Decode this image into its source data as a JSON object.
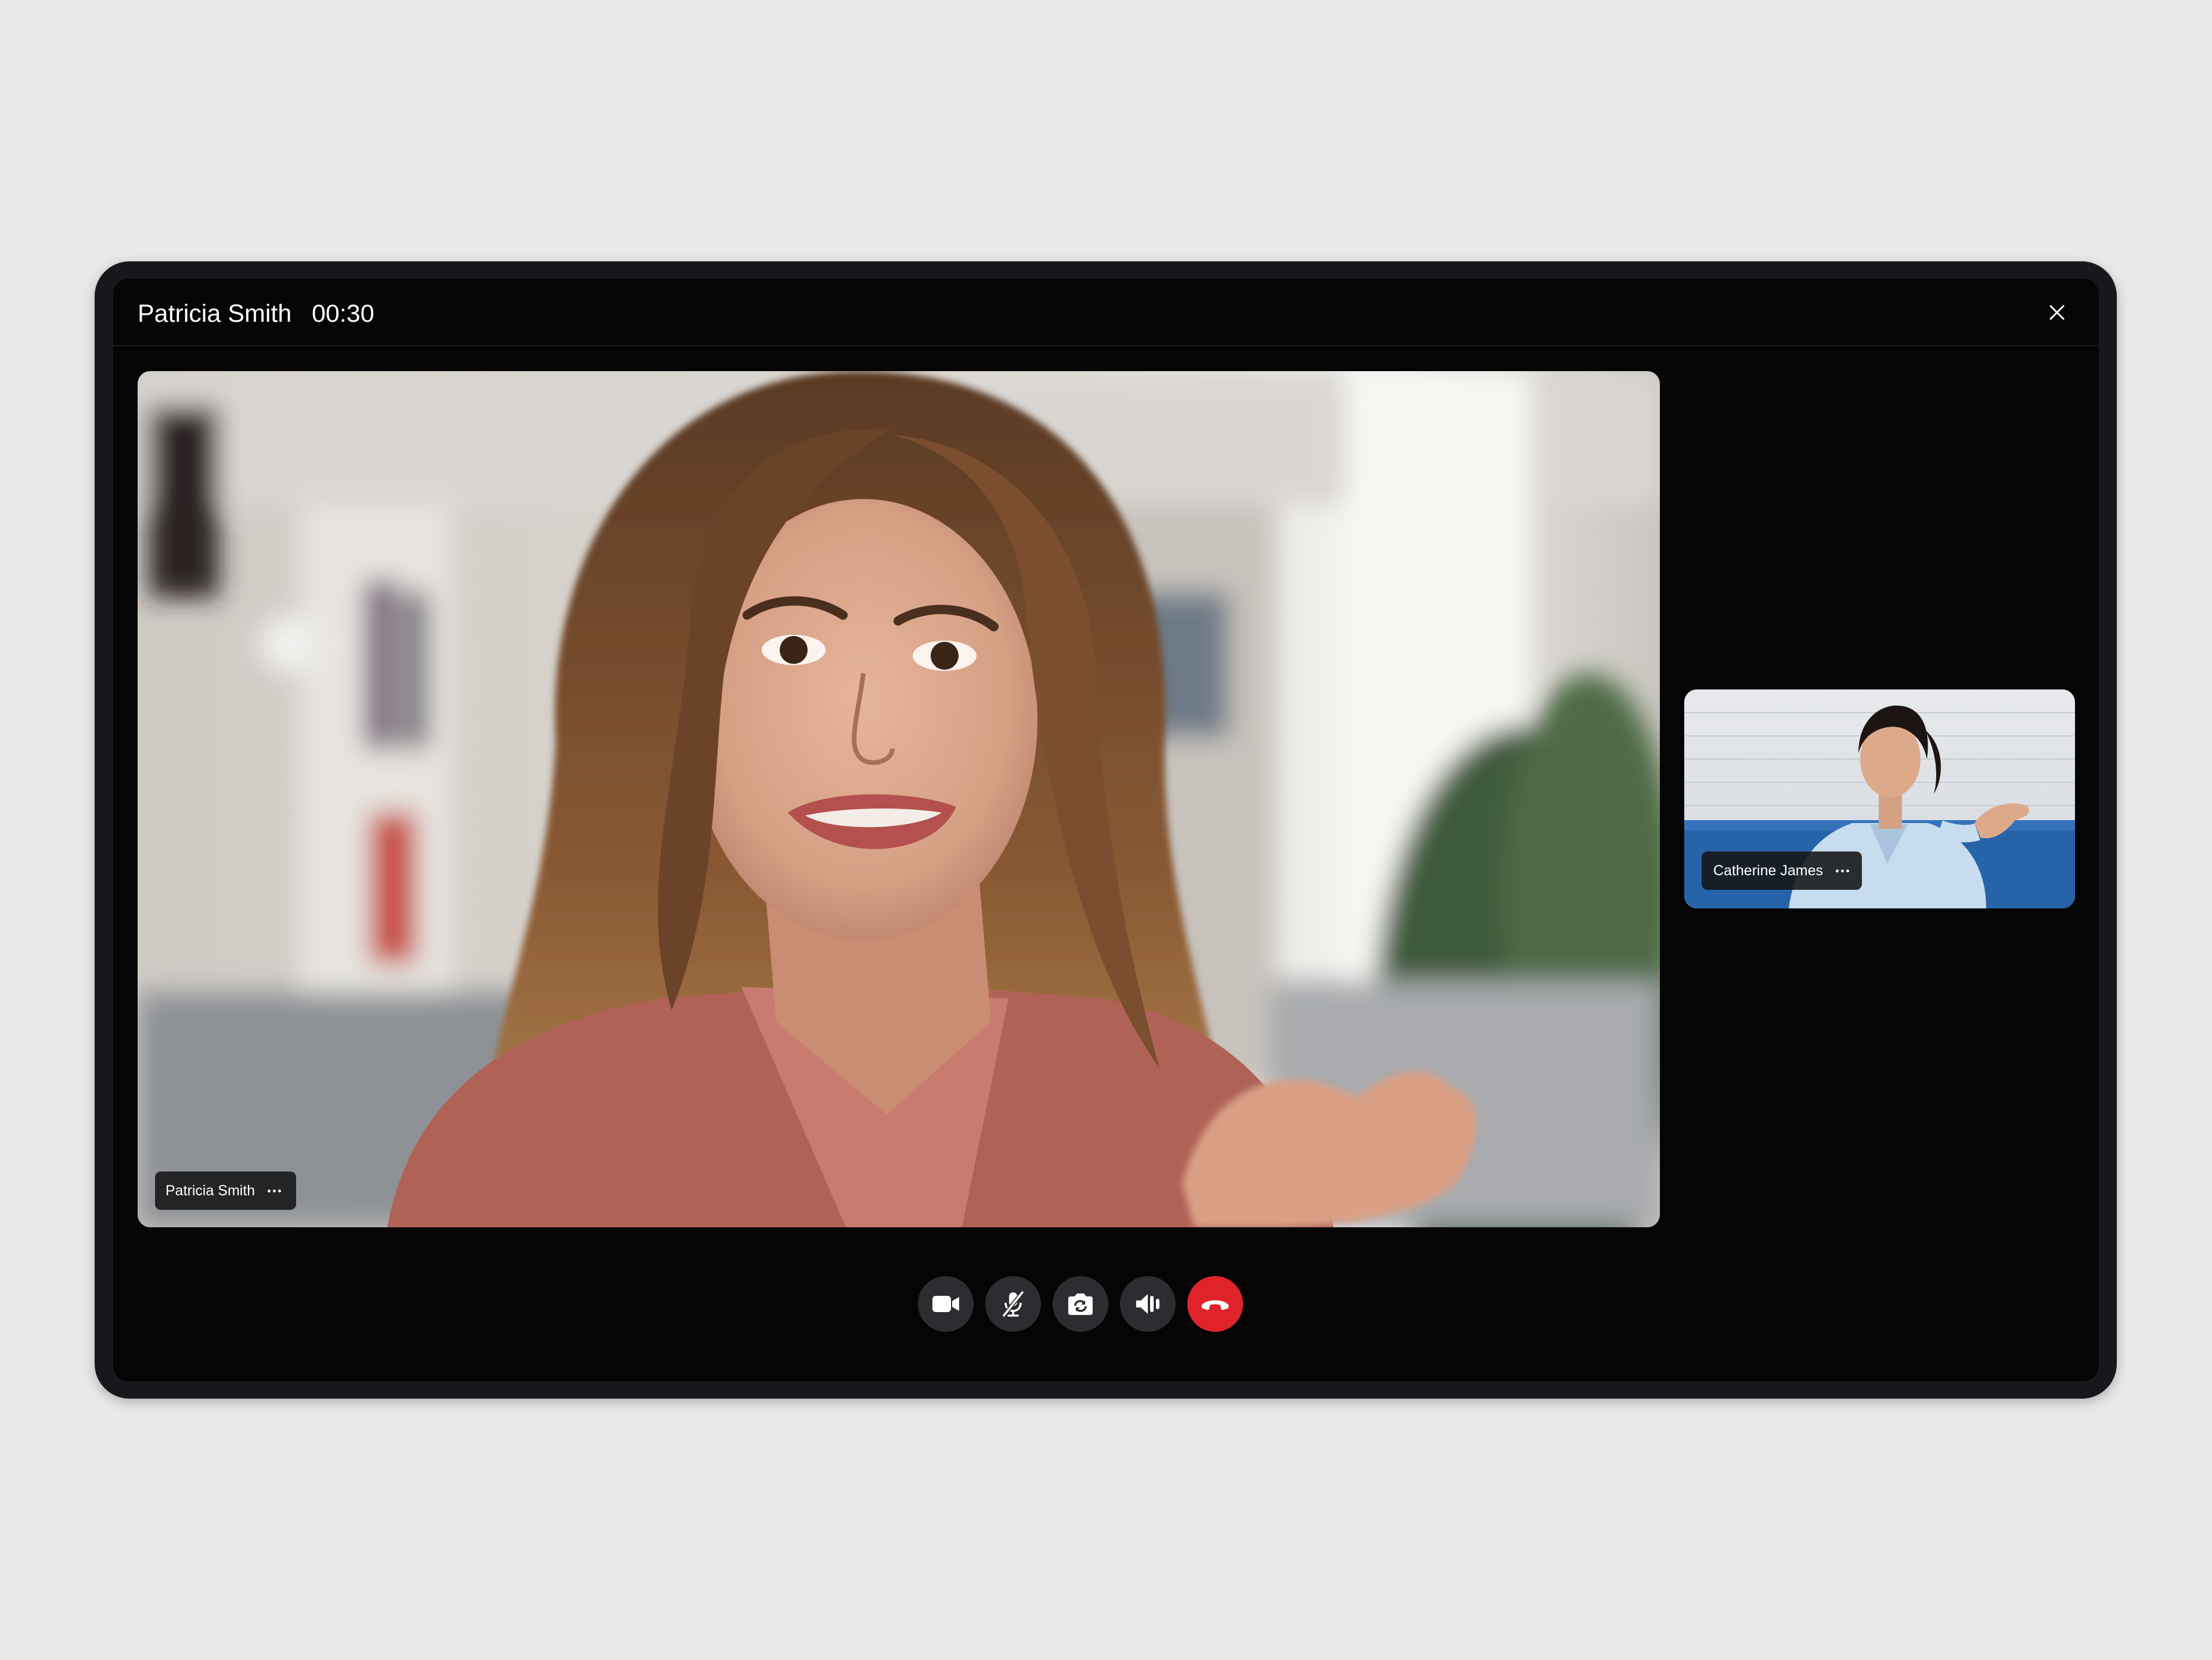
{
  "call": {
    "caller_name": "Patricia Smith",
    "timer": "00:30"
  },
  "main_participant": {
    "name": "Patricia Smith"
  },
  "side_participant": {
    "name": "Catherine James"
  },
  "controls": [
    {
      "icon": "video-camera-icon"
    },
    {
      "icon": "microphone-muted-icon"
    },
    {
      "icon": "switch-camera-icon"
    },
    {
      "icon": "speaker-icon"
    },
    {
      "icon": "end-call-icon",
      "color": "#e0232b"
    }
  ],
  "colors": {
    "page_background": "#e9e9e9",
    "frame": "#17181b",
    "screen": "#050505",
    "control_button": "#2c2d30",
    "end_call": "#e0232b"
  }
}
